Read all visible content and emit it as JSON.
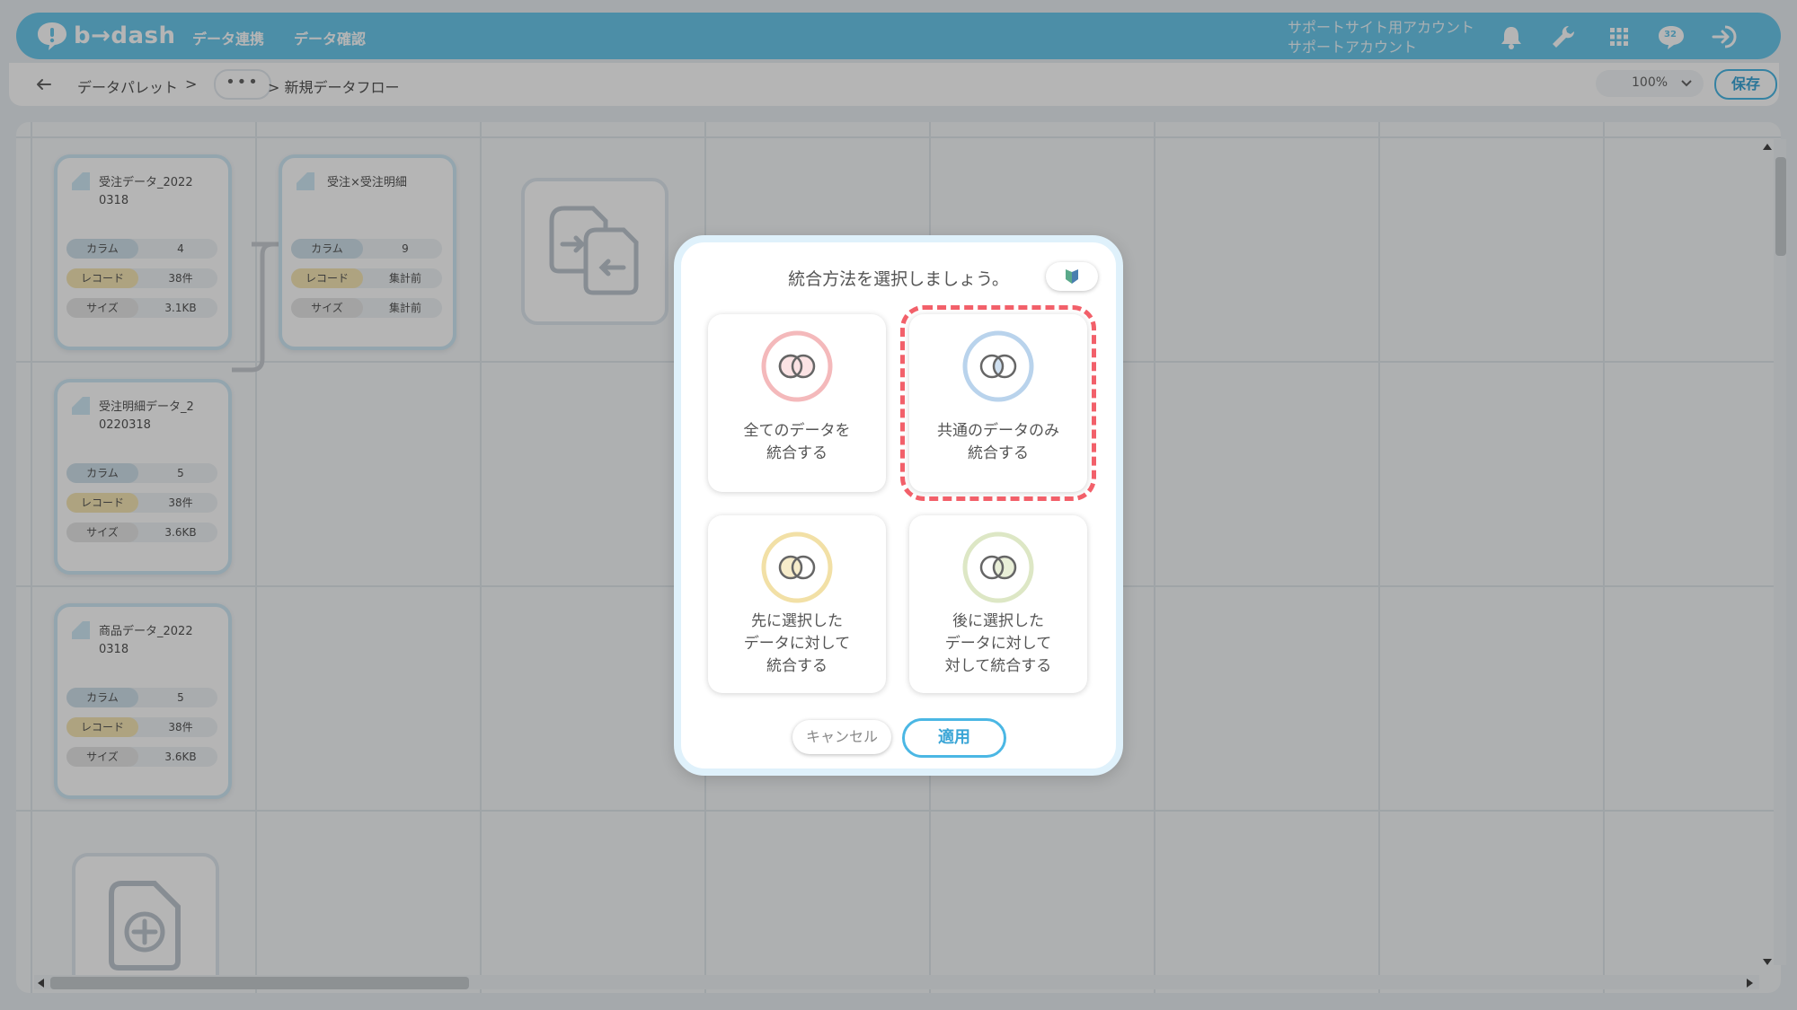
{
  "header": {
    "logo_text": "b→dash",
    "nav": [
      "データ連携",
      "データ確認"
    ],
    "account_line1": "サポートサイト用アカウント",
    "account_line2": "サポートアカウント",
    "notification_badge": "32"
  },
  "toolbar": {
    "breadcrumb_root": "データパレット",
    "breadcrumb_sep": ">",
    "breadcrumb_more": "•••",
    "breadcrumb_current": "> 新規データフロー",
    "zoom": "100%",
    "save_label": "保存"
  },
  "canvas": {
    "cards": [
      {
        "title": "受注データ_2022\n0318",
        "rows": [
          {
            "label": "カラム",
            "value": "4"
          },
          {
            "label": "レコード",
            "value": "38件"
          },
          {
            "label": "サイズ",
            "value": "3.1KB"
          }
        ]
      },
      {
        "title": "受注×受注明細",
        "rows": [
          {
            "label": "カラム",
            "value": "9"
          },
          {
            "label": "レコード",
            "value": "集計前"
          },
          {
            "label": "サイズ",
            "value": "集計前"
          }
        ]
      },
      {
        "title": "受注明細データ_2\n0220318",
        "rows": [
          {
            "label": "カラム",
            "value": "5"
          },
          {
            "label": "レコード",
            "value": "38件"
          },
          {
            "label": "サイズ",
            "value": "3.6KB"
          }
        ]
      },
      {
        "title": "商品データ_2022\n0318",
        "rows": [
          {
            "label": "カラム",
            "value": "5"
          },
          {
            "label": "レコード",
            "value": "38件"
          },
          {
            "label": "サイズ",
            "value": "3.6KB"
          }
        ]
      }
    ]
  },
  "modal": {
    "title": "統合方法を選択しましょう。",
    "options": [
      {
        "label": "全てのデータを\n統合する",
        "color": "#f4b9bb"
      },
      {
        "label": "共通のデータのみ\n統合する",
        "color": "#b9d3ec",
        "selected": true
      },
      {
        "label": "先に選択した\nデータに対して\n統合する",
        "color": "#f2e0a6"
      },
      {
        "label": "後に選択した\nデータに対して\n対して統合する",
        "color": "#dde7c5"
      }
    ],
    "cancel_label": "キャンセル",
    "apply_label": "適用"
  },
  "colors": {
    "header_bg": "#6bc8ec",
    "accent": "#4bb7e4",
    "highlight": "#f2606a"
  }
}
